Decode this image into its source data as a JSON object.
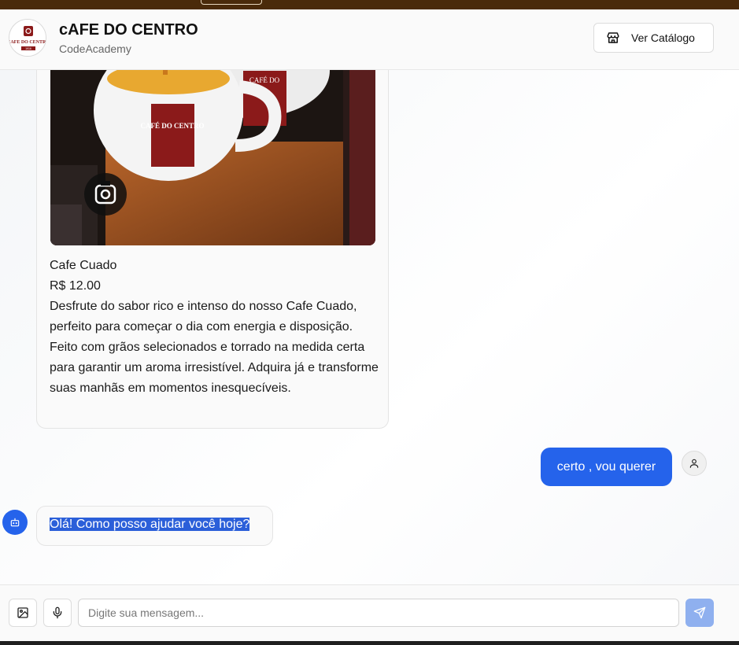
{
  "header": {
    "title": "cAFE DO CENTRO",
    "subtitle": "CodeAcademy",
    "catalog_label": "Ver Catálogo",
    "logo_text": "CAFE DO CENTRO 1916"
  },
  "product": {
    "name": "Cafe Cuado",
    "price": "R$ 12.00",
    "description": "Desfrute do sabor rico e intenso do nosso Cafe Cuado, perfeito para começar o dia com energia e disposição. Feito com grãos selecionados e torrado na medida certa para garantir um aroma irresistível. Adquira já e transforme suas manhãs em momentos inesquecíveis.",
    "image_icon": "lens-icon",
    "cup_label": "CAFÉ DO CENTRO"
  },
  "messages": [
    {
      "role": "user",
      "text": "certo , vou querer"
    },
    {
      "role": "bot",
      "text": "Olá! Como posso ajudar você hoje?"
    }
  ],
  "composer": {
    "placeholder": "Digite sua mensagem...",
    "value": ""
  },
  "colors": {
    "accent": "#2563eb",
    "send_disabled": "#8fb0ef",
    "topbar": "#4a2a0a"
  }
}
